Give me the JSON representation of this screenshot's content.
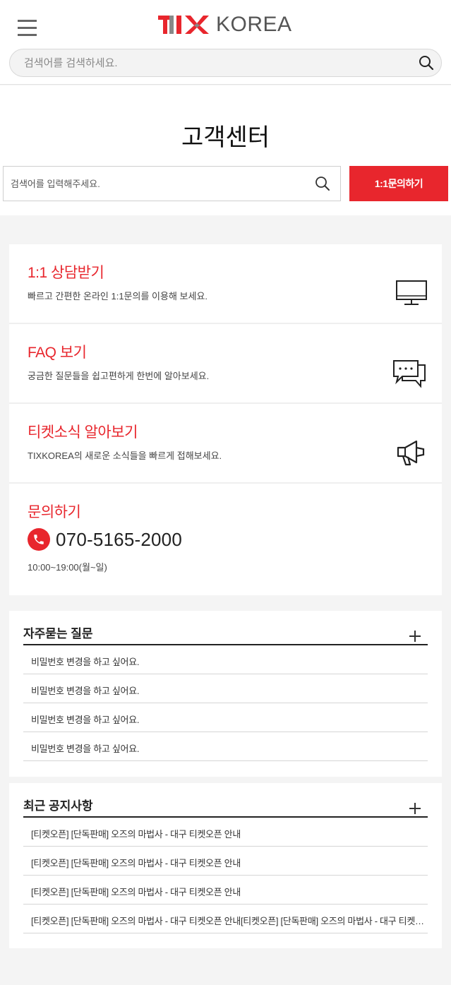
{
  "header": {
    "logo_text": "KOREA",
    "search_placeholder": "검색어를 검색하세요."
  },
  "customer_center": {
    "title": "고객센터",
    "search_placeholder": "검색어를 입력해주세요.",
    "inquiry_button": "1:1문의하기"
  },
  "cards": [
    {
      "title": "1:1 상담받기",
      "desc": "빠르고 간편한 온라인 1:1문의를 이용해 보세요.",
      "icon": "monitor-icon"
    },
    {
      "title": "FAQ 보기",
      "desc": "궁금한 질문들을 쉽고편하게 한번에 알아보세요.",
      "icon": "chat-bubbles-icon"
    },
    {
      "title": "티켓소식 알아보기",
      "desc": "TIXKOREA의 새로운 소식들을 빠르게 접해보세요.",
      "icon": "megaphone-icon"
    }
  ],
  "contact": {
    "title": "문의하기",
    "phone": "070-5165-2000",
    "hours": "10:00~19:00(월~일)",
    "icon": "phone-icon"
  },
  "faq": {
    "title": "자주묻는 질문",
    "items": [
      "비밀번호 변경을 하고 싶어요.",
      "비밀번호 변경을 하고 싶어요.",
      "비밀번호 변경을 하고 싶어요.",
      "비밀번호 변경을 하고 싶어요."
    ]
  },
  "notices": {
    "title": "최근 공지사항",
    "items": [
      "[티켓오픈] [단독판매] 오즈의 마법사 - 대구 티켓오픈 안내",
      "[티켓오픈] [단독판매] 오즈의 마법사 - 대구 티켓오픈 안내",
      "[티켓오픈] [단독판매] 오즈의 마법사 - 대구 티켓오픈 안내",
      "[티켓오픈] [단독판매] 오즈의 마법사 - 대구 티켓오픈 안내[티켓오픈] [단독판매] 오즈의 마법사 - 대구 티켓오픈 안내[티켓오픈]"
    ]
  },
  "colors": {
    "accent": "#e8262d",
    "logo_gray": "#555555"
  }
}
